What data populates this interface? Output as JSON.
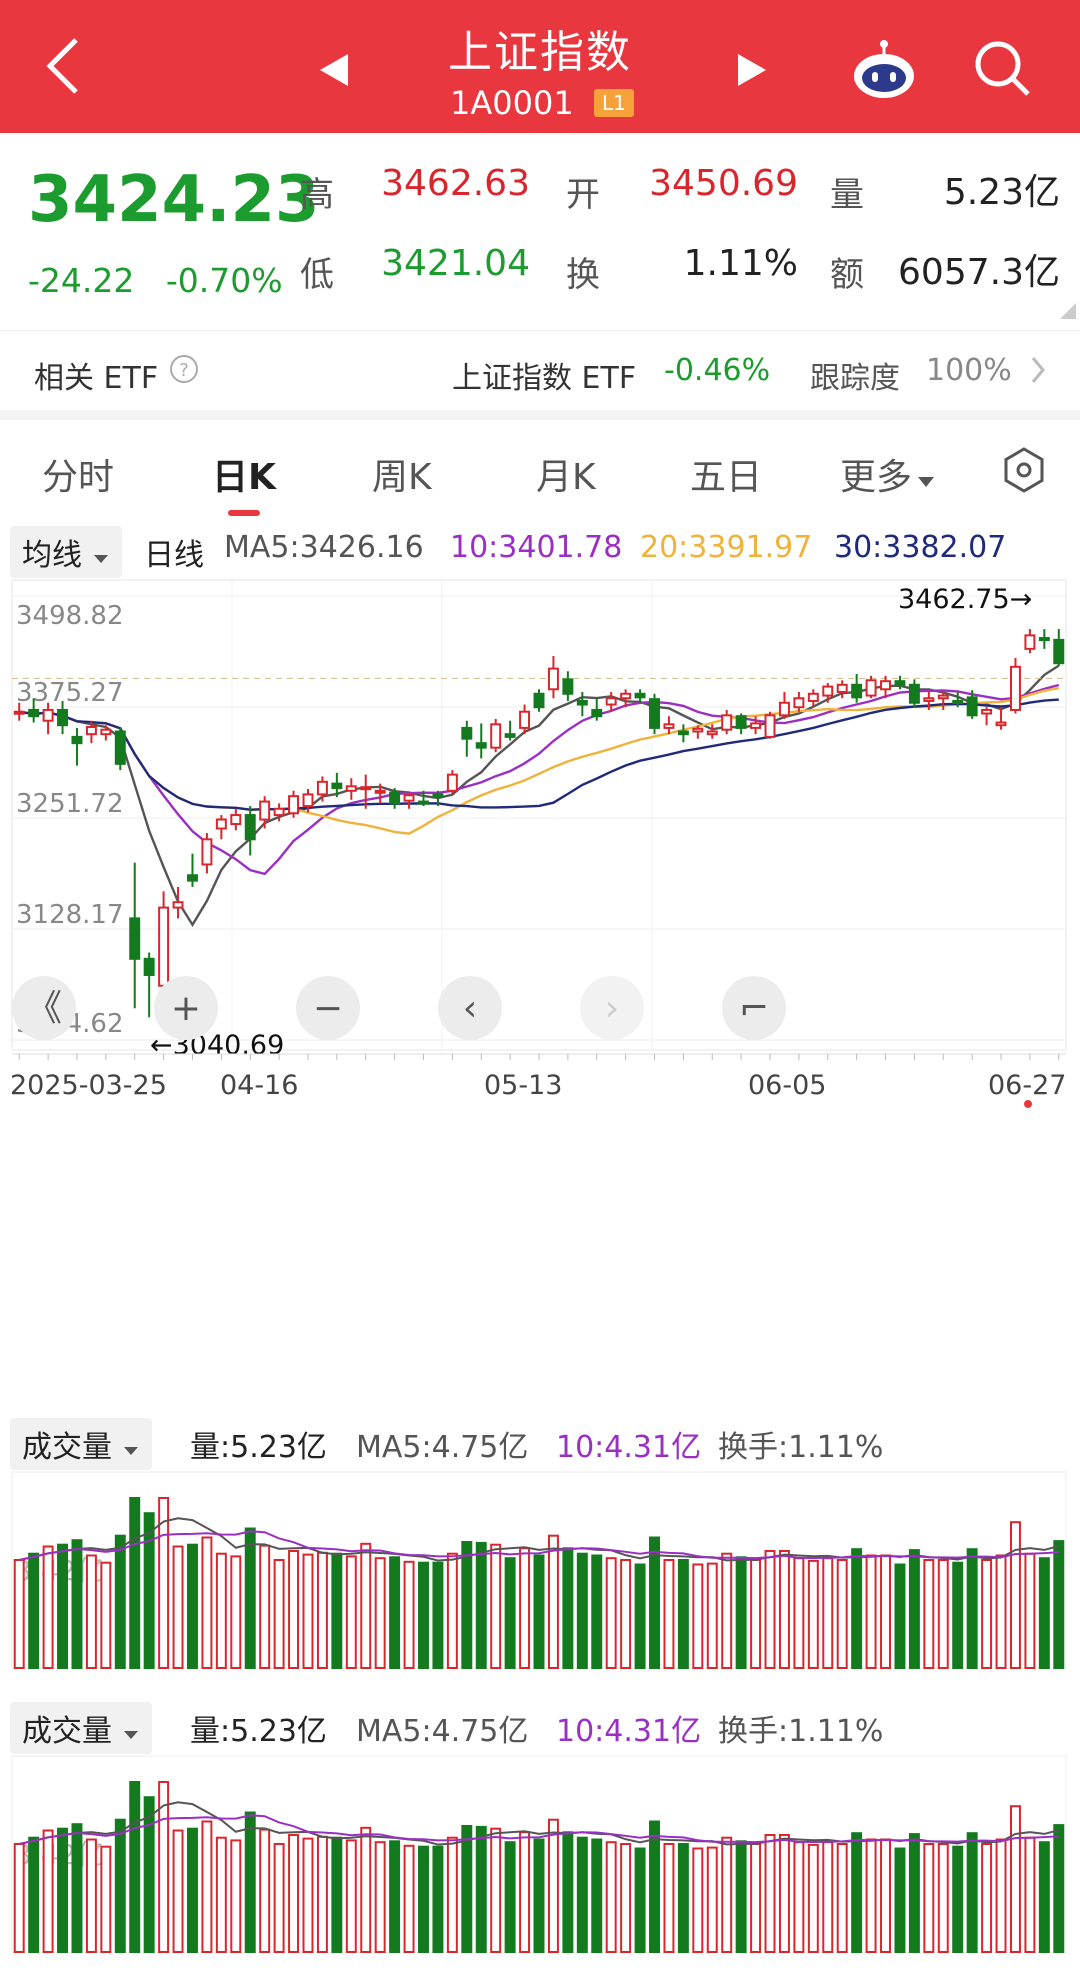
{
  "header": {
    "title": "上证指数",
    "code": "1A0001",
    "level_badge": "L1",
    "bg": "#e9373f"
  },
  "quote": {
    "price": "3424.23",
    "change": "-24.22",
    "change_pct": "-0.70%",
    "high_label": "高",
    "high": "3462.63",
    "low_label": "低",
    "low": "3421.04",
    "open_label": "开",
    "open": "3450.69",
    "turnover_label": "换",
    "turnover": "1.11%",
    "volume_label": "量",
    "volume": "5.23亿",
    "amount_label": "额",
    "amount": "6057.3亿"
  },
  "etf": {
    "label": "相关 ETF",
    "name": "上证指数 ETF",
    "change": "-0.46%",
    "tracking_label": "跟踪度",
    "tracking": "100%"
  },
  "tabs": [
    "分时",
    "日K",
    "周K",
    "月K",
    "五日",
    "更多"
  ],
  "ma_bar": {
    "selector": "均线",
    "period": "日线",
    "ma5": "MA5:3426.16",
    "ma10": "10:3401.78",
    "ma20": "20:3391.97",
    "ma30": "30:3382.07"
  },
  "volume_panel": {
    "selector": "成交量",
    "vol": "量:5.23亿",
    "ma5": "MA5:4.75亿",
    "ma10": "10:4.31亿",
    "turnover": "换手:1.11%",
    "watermark": "3.42亿"
  },
  "colors": {
    "up": "#d9262d",
    "down": "#137a1e",
    "ma5": "#555555",
    "ma10": "#9b2fc4",
    "ma20": "#f0b23a",
    "ma30": "#1f2b7a"
  },
  "chart_data": {
    "type": "candlestick",
    "y_ticks": [
      "3498.82",
      "3375.27",
      "3251.72",
      "3128.17",
      "3004.62"
    ],
    "ylim": [
      3004.62,
      3498.82
    ],
    "x_ticks": [
      "2025-03-25",
      "04-16",
      "05-13",
      "06-05",
      "06-27"
    ],
    "max_marker": "3462.75→",
    "min_marker": "←3040.69",
    "grid": true,
    "candles": [
      {
        "o": 3370,
        "h": 3380,
        "l": 3360,
        "c": 3370
      },
      {
        "o": 3372,
        "h": 3385,
        "l": 3358,
        "c": 3365
      },
      {
        "o": 3360,
        "h": 3380,
        "l": 3345,
        "c": 3372
      },
      {
        "o": 3372,
        "h": 3382,
        "l": 3345,
        "c": 3355
      },
      {
        "o": 3342,
        "h": 3352,
        "l": 3310,
        "c": 3335
      },
      {
        "o": 3345,
        "h": 3360,
        "l": 3335,
        "c": 3353
      },
      {
        "o": 3345,
        "h": 3355,
        "l": 3338,
        "c": 3350
      },
      {
        "o": 3348,
        "h": 3352,
        "l": 3305,
        "c": 3312
      },
      {
        "o": 3140,
        "h": 3202,
        "l": 3040,
        "c": 3095
      },
      {
        "o": 3095,
        "h": 3102,
        "l": 3030,
        "c": 3077
      },
      {
        "o": 3065,
        "h": 3170,
        "l": 3055,
        "c": 3152
      },
      {
        "o": 3152,
        "h": 3175,
        "l": 3140,
        "c": 3158
      },
      {
        "o": 3188,
        "h": 3212,
        "l": 3175,
        "c": 3182
      },
      {
        "o": 3200,
        "h": 3235,
        "l": 3190,
        "c": 3228
      },
      {
        "o": 3240,
        "h": 3255,
        "l": 3228,
        "c": 3250
      },
      {
        "o": 3245,
        "h": 3262,
        "l": 3238,
        "c": 3255
      },
      {
        "o": 3255,
        "h": 3265,
        "l": 3210,
        "c": 3228
      },
      {
        "o": 3250,
        "h": 3276,
        "l": 3240,
        "c": 3270
      },
      {
        "o": 3255,
        "h": 3268,
        "l": 3248,
        "c": 3262
      },
      {
        "o": 3257,
        "h": 3282,
        "l": 3252,
        "c": 3276
      },
      {
        "o": 3265,
        "h": 3284,
        "l": 3258,
        "c": 3278
      },
      {
        "o": 3278,
        "h": 3298,
        "l": 3270,
        "c": 3292
      },
      {
        "o": 3290,
        "h": 3302,
        "l": 3275,
        "c": 3285
      },
      {
        "o": 3282,
        "h": 3296,
        "l": 3272,
        "c": 3287
      },
      {
        "o": 3285,
        "h": 3300,
        "l": 3262,
        "c": 3286
      },
      {
        "o": 3280,
        "h": 3290,
        "l": 3268,
        "c": 3282
      },
      {
        "o": 3280,
        "h": 3285,
        "l": 3262,
        "c": 3268
      },
      {
        "o": 3271,
        "h": 3280,
        "l": 3262,
        "c": 3277
      },
      {
        "o": 3270,
        "h": 3282,
        "l": 3265,
        "c": 3268
      },
      {
        "o": 3278,
        "h": 3282,
        "l": 3265,
        "c": 3275
      },
      {
        "o": 3282,
        "h": 3305,
        "l": 3278,
        "c": 3300
      },
      {
        "o": 3352,
        "h": 3360,
        "l": 3320,
        "c": 3340
      },
      {
        "o": 3335,
        "h": 3357,
        "l": 3318,
        "c": 3330
      },
      {
        "o": 3330,
        "h": 3362,
        "l": 3325,
        "c": 3356
      },
      {
        "o": 3345,
        "h": 3360,
        "l": 3338,
        "c": 3342
      },
      {
        "o": 3352,
        "h": 3378,
        "l": 3345,
        "c": 3370
      },
      {
        "o": 3390,
        "h": 3395,
        "l": 3370,
        "c": 3375
      },
      {
        "o": 3395,
        "h": 3432,
        "l": 3385,
        "c": 3418
      },
      {
        "o": 3406,
        "h": 3415,
        "l": 3382,
        "c": 3390
      },
      {
        "o": 3382,
        "h": 3392,
        "l": 3365,
        "c": 3378
      },
      {
        "o": 3372,
        "h": 3385,
        "l": 3360,
        "c": 3365
      },
      {
        "o": 3378,
        "h": 3392,
        "l": 3370,
        "c": 3385
      },
      {
        "o": 3385,
        "h": 3395,
        "l": 3375,
        "c": 3390
      },
      {
        "o": 3390,
        "h": 3395,
        "l": 3380,
        "c": 3386
      },
      {
        "o": 3384,
        "h": 3390,
        "l": 3345,
        "c": 3352
      },
      {
        "o": 3352,
        "h": 3365,
        "l": 3345,
        "c": 3356
      },
      {
        "o": 3348,
        "h": 3356,
        "l": 3336,
        "c": 3345
      },
      {
        "o": 3348,
        "h": 3355,
        "l": 3340,
        "c": 3351
      },
      {
        "o": 3345,
        "h": 3356,
        "l": 3340,
        "c": 3348
      },
      {
        "o": 3350,
        "h": 3372,
        "l": 3345,
        "c": 3366
      },
      {
        "o": 3365,
        "h": 3368,
        "l": 3345,
        "c": 3352
      },
      {
        "o": 3352,
        "h": 3365,
        "l": 3345,
        "c": 3357
      },
      {
        "o": 3342,
        "h": 3370,
        "l": 3340,
        "c": 3366
      },
      {
        "o": 3366,
        "h": 3392,
        "l": 3362,
        "c": 3380
      },
      {
        "o": 3375,
        "h": 3392,
        "l": 3370,
        "c": 3385
      },
      {
        "o": 3382,
        "h": 3395,
        "l": 3376,
        "c": 3390
      },
      {
        "o": 3388,
        "h": 3402,
        "l": 3380,
        "c": 3398
      },
      {
        "o": 3392,
        "h": 3405,
        "l": 3385,
        "c": 3400
      },
      {
        "o": 3400,
        "h": 3412,
        "l": 3380,
        "c": 3386
      },
      {
        "o": 3388,
        "h": 3410,
        "l": 3385,
        "c": 3405
      },
      {
        "o": 3395,
        "h": 3410,
        "l": 3385,
        "c": 3404
      },
      {
        "o": 3404,
        "h": 3410,
        "l": 3395,
        "c": 3400
      },
      {
        "o": 3400,
        "h": 3406,
        "l": 3375,
        "c": 3380
      },
      {
        "o": 3382,
        "h": 3392,
        "l": 3372,
        "c": 3385
      },
      {
        "o": 3385,
        "h": 3392,
        "l": 3372,
        "c": 3388
      },
      {
        "o": 3382,
        "h": 3392,
        "l": 3375,
        "c": 3380
      },
      {
        "o": 3386,
        "h": 3394,
        "l": 3362,
        "c": 3366
      },
      {
        "o": 3368,
        "h": 3375,
        "l": 3355,
        "c": 3372
      },
      {
        "o": 3355,
        "h": 3375,
        "l": 3350,
        "c": 3358
      },
      {
        "o": 3372,
        "h": 3430,
        "l": 3368,
        "c": 3420
      },
      {
        "o": 3440,
        "h": 3462,
        "l": 3435,
        "c": 3455
      },
      {
        "o": 3452,
        "h": 3462,
        "l": 3440,
        "c": 3450
      },
      {
        "o": 3450,
        "h": 3462,
        "l": 3421,
        "c": 3424
      }
    ]
  }
}
